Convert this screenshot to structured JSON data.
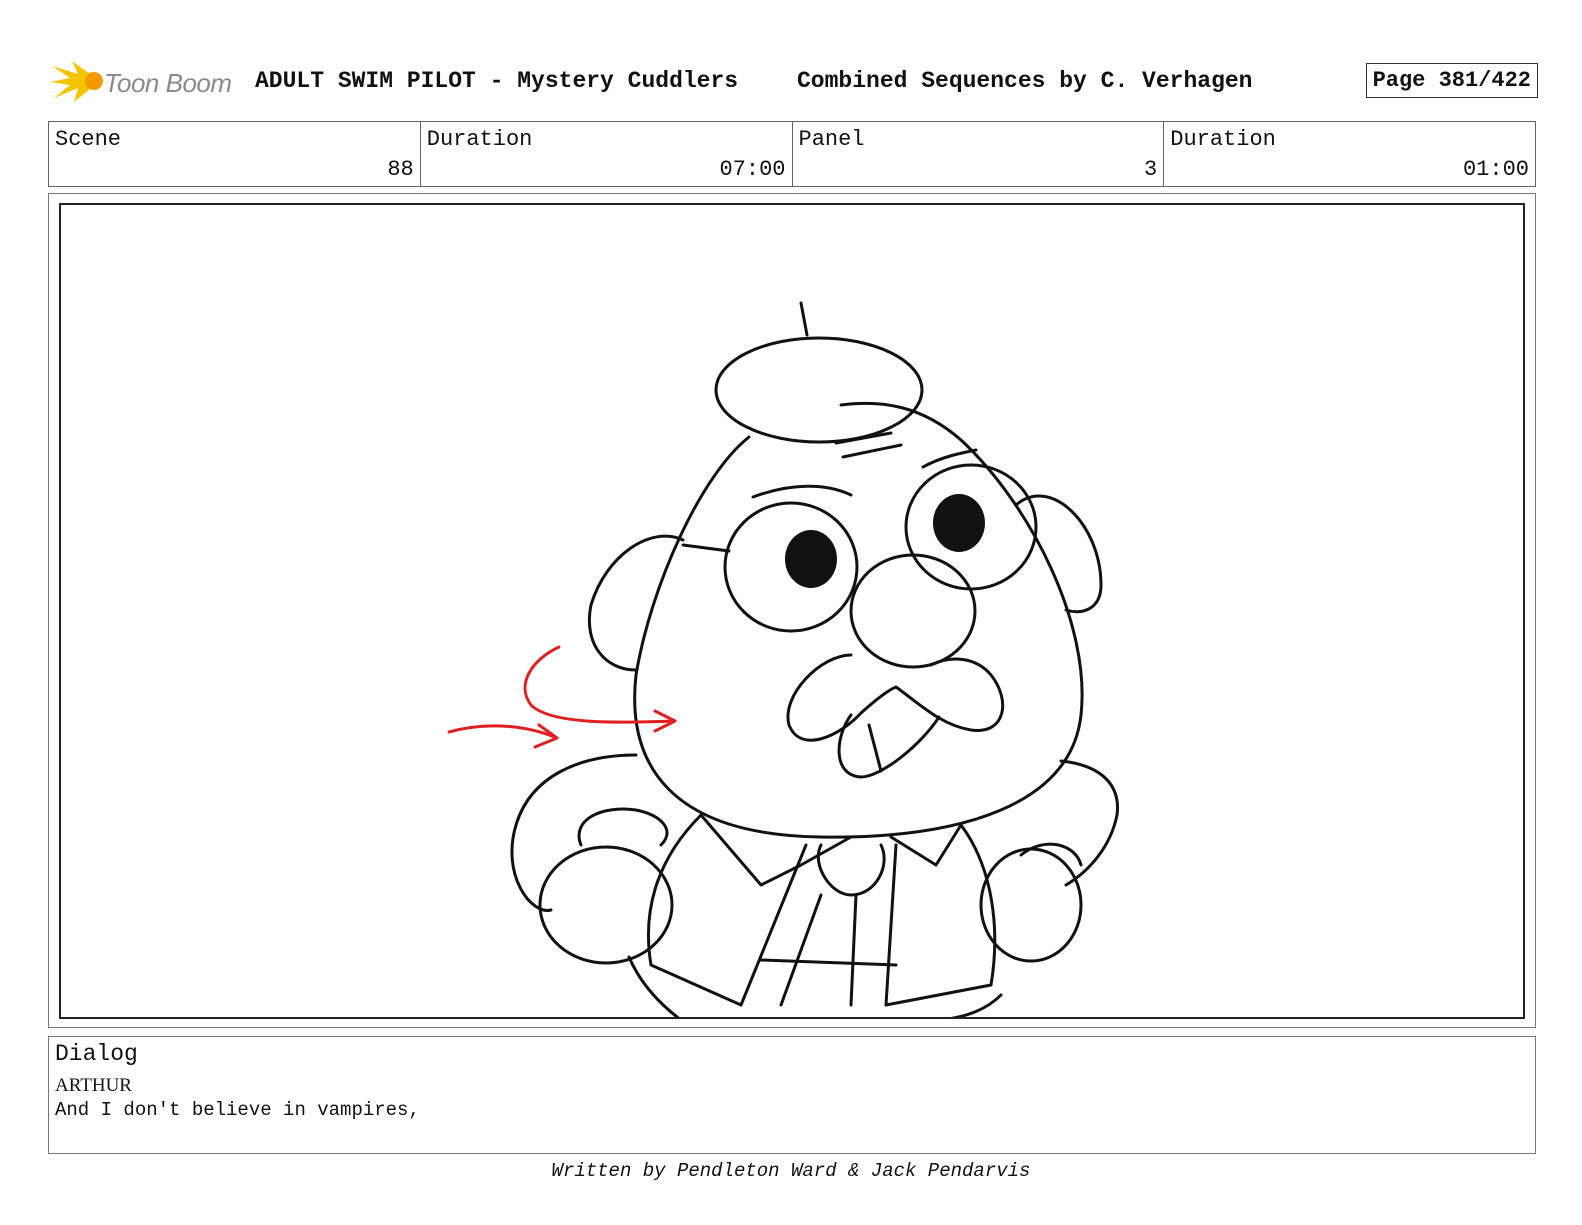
{
  "header": {
    "logo_text": "Toon Boom",
    "title": "ADULT SWIM PILOT - Mystery Cuddlers",
    "subtitle": "Combined Sequences by C. Verhagen",
    "page": "Page 381/422"
  },
  "info": {
    "scene_label": "Scene",
    "scene_value": "88",
    "scene_duration_label": "Duration",
    "scene_duration_value": "07:00",
    "panel_label": "Panel",
    "panel_value": "3",
    "panel_duration_label": "Duration",
    "panel_duration_value": "01:00"
  },
  "dialog": {
    "label": "Dialog",
    "speaker": "ARTHUR",
    "line": "And I don't believe in vampires,"
  },
  "footer": {
    "credit": "Written by Pendleton Ward & Jack Pendarvis"
  },
  "colors": {
    "logo_yellow": "#f5c400",
    "logo_orange": "#f39a00",
    "arrow_red": "#e02020",
    "ink": "#111111"
  }
}
